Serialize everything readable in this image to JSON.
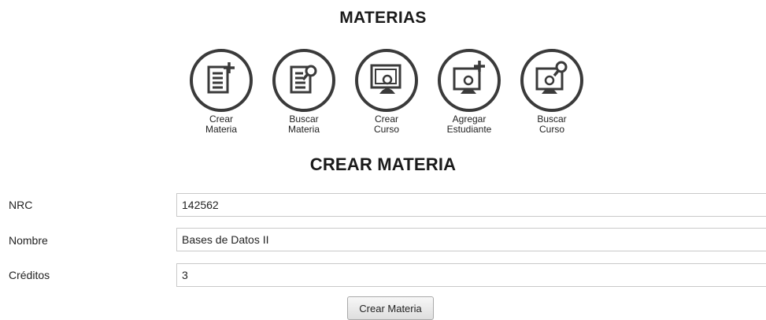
{
  "header": {
    "title": "MATERIAS"
  },
  "nav": [
    {
      "icon": "new-document-icon",
      "line1": "Crear",
      "line2": "Materia"
    },
    {
      "icon": "search-document-icon",
      "line1": "Buscar",
      "line2": "Materia"
    },
    {
      "icon": "course-presenter-icon",
      "line1": "Crear",
      "line2": "Curso"
    },
    {
      "icon": "add-student-icon",
      "line1": "Agregar",
      "line2": "Estudiante"
    },
    {
      "icon": "search-course-icon",
      "line1": "Buscar",
      "line2": "Curso"
    }
  ],
  "form": {
    "title": "CREAR MATERIA",
    "fields": [
      {
        "label": "NRC",
        "value": "142562"
      },
      {
        "label": "Nombre",
        "value": "Bases de Datos II"
      },
      {
        "label": "Créditos",
        "value": "3"
      }
    ],
    "submit_label": "Crear Materia"
  },
  "colors": {
    "icon_stroke": "#3a3a3a",
    "text": "#222222"
  }
}
